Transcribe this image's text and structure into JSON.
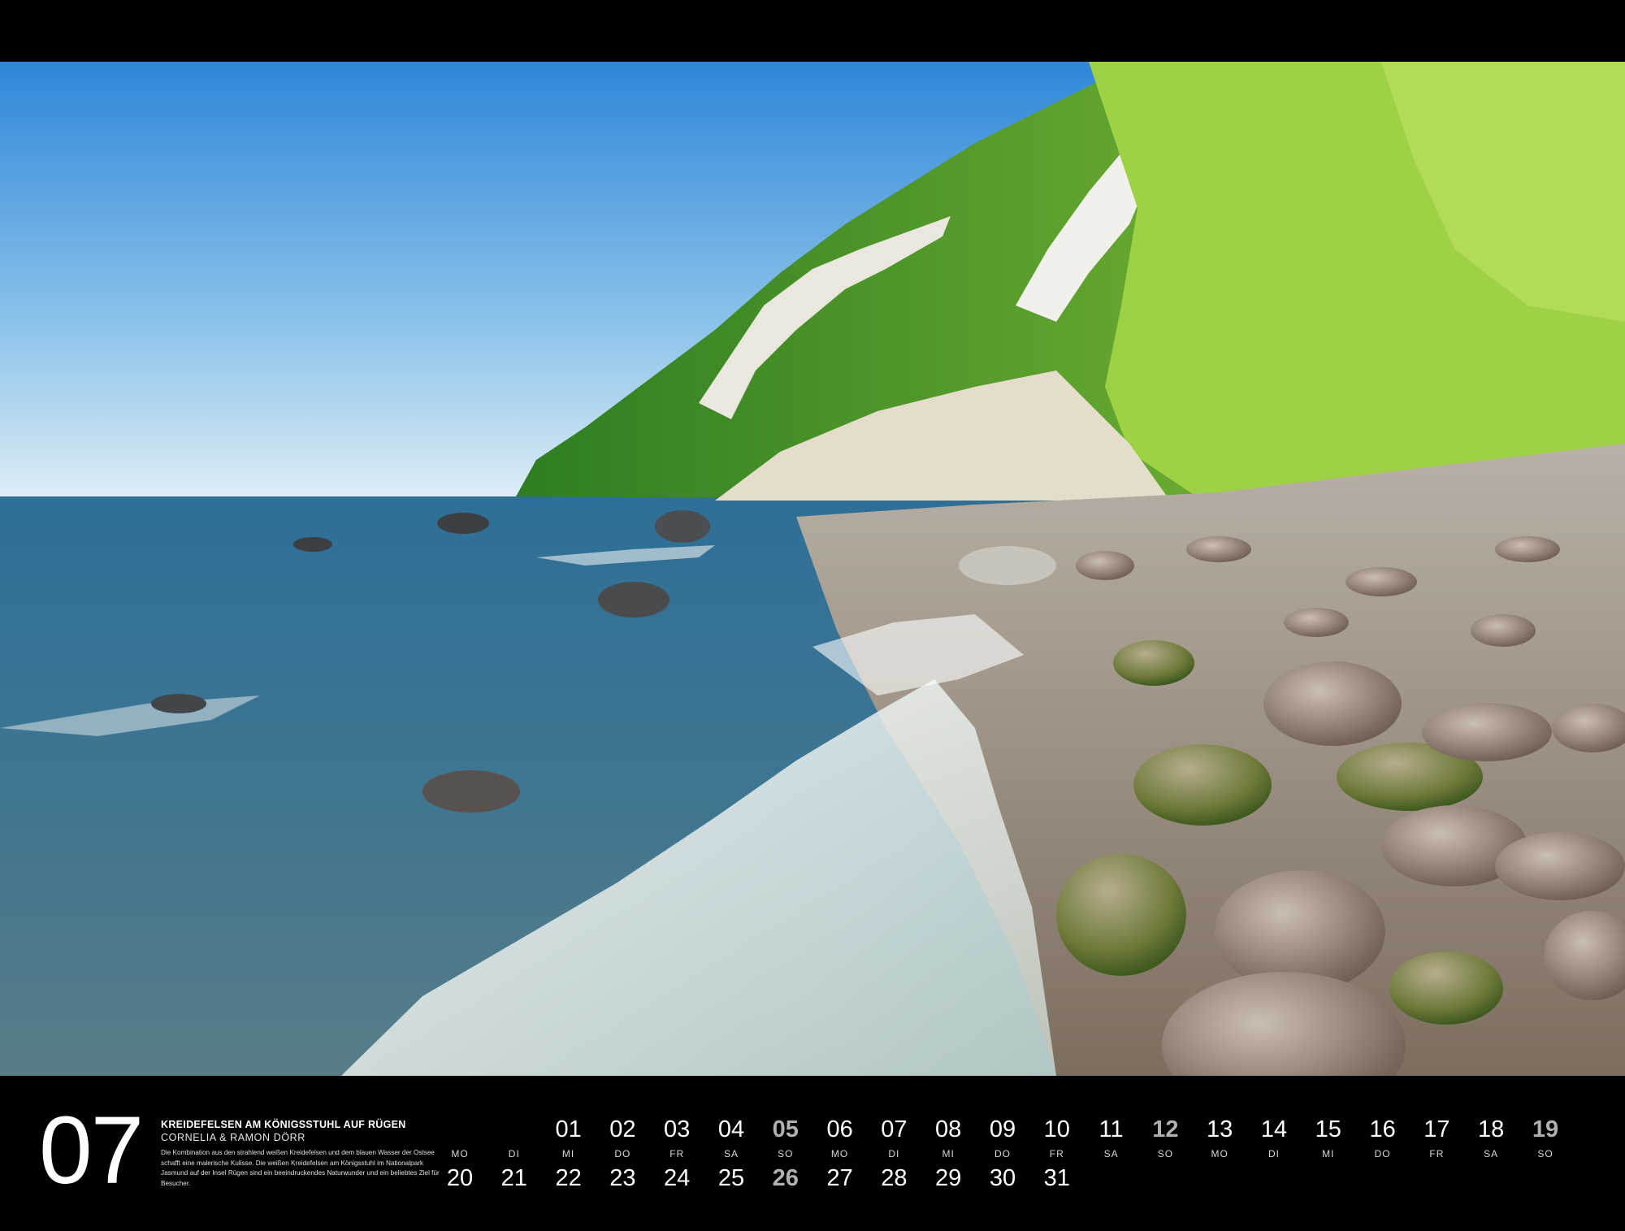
{
  "calendar": {
    "month_number": "07",
    "photo": {
      "title": "KREIDEFELSEN AM KÖNIGSSTUHL AUF RÜGEN",
      "photographers": "CORNELIA & RAMON DÖRR",
      "description": "Die Kombination aus den strahlend weißen Kreidefelsen und dem blauen Wasser der Ostsee schafft eine malerische Kulisse. Die weißen Kreidefelsen am Königsstuhl im Nationalpark Jasmund auf der Insel Rügen sind ein beeindruckendes Naturwunder und ein beliebtes Ziel für Besucher."
    },
    "weekdays": [
      "MO",
      "DI",
      "MI",
      "DO",
      "FR",
      "SA",
      "SO",
      "MO",
      "DI",
      "MI",
      "DO",
      "FR",
      "SA",
      "SO",
      "MO",
      "DI",
      "MI",
      "DO",
      "FR",
      "SA",
      "SO"
    ],
    "row1_days": [
      {
        "num": "",
        "sunday": false
      },
      {
        "num": "",
        "sunday": false
      },
      {
        "num": "01",
        "sunday": false
      },
      {
        "num": "02",
        "sunday": false
      },
      {
        "num": "03",
        "sunday": false
      },
      {
        "num": "04",
        "sunday": false
      },
      {
        "num": "05",
        "sunday": true
      },
      {
        "num": "06",
        "sunday": false
      },
      {
        "num": "07",
        "sunday": false
      },
      {
        "num": "08",
        "sunday": false
      },
      {
        "num": "09",
        "sunday": false
      },
      {
        "num": "10",
        "sunday": false
      },
      {
        "num": "11",
        "sunday": false
      },
      {
        "num": "12",
        "sunday": true
      },
      {
        "num": "13",
        "sunday": false
      },
      {
        "num": "14",
        "sunday": false
      },
      {
        "num": "15",
        "sunday": false
      },
      {
        "num": "16",
        "sunday": false
      },
      {
        "num": "17",
        "sunday": false
      },
      {
        "num": "18",
        "sunday": false
      },
      {
        "num": "19",
        "sunday": true
      }
    ],
    "row2_days": [
      {
        "num": "20",
        "sunday": false
      },
      {
        "num": "21",
        "sunday": false
      },
      {
        "num": "22",
        "sunday": false
      },
      {
        "num": "23",
        "sunday": false
      },
      {
        "num": "24",
        "sunday": false
      },
      {
        "num": "25",
        "sunday": false
      },
      {
        "num": "26",
        "sunday": true
      },
      {
        "num": "27",
        "sunday": false
      },
      {
        "num": "28",
        "sunday": false
      },
      {
        "num": "29",
        "sunday": false
      },
      {
        "num": "30",
        "sunday": false
      },
      {
        "num": "31",
        "sunday": false
      }
    ]
  }
}
